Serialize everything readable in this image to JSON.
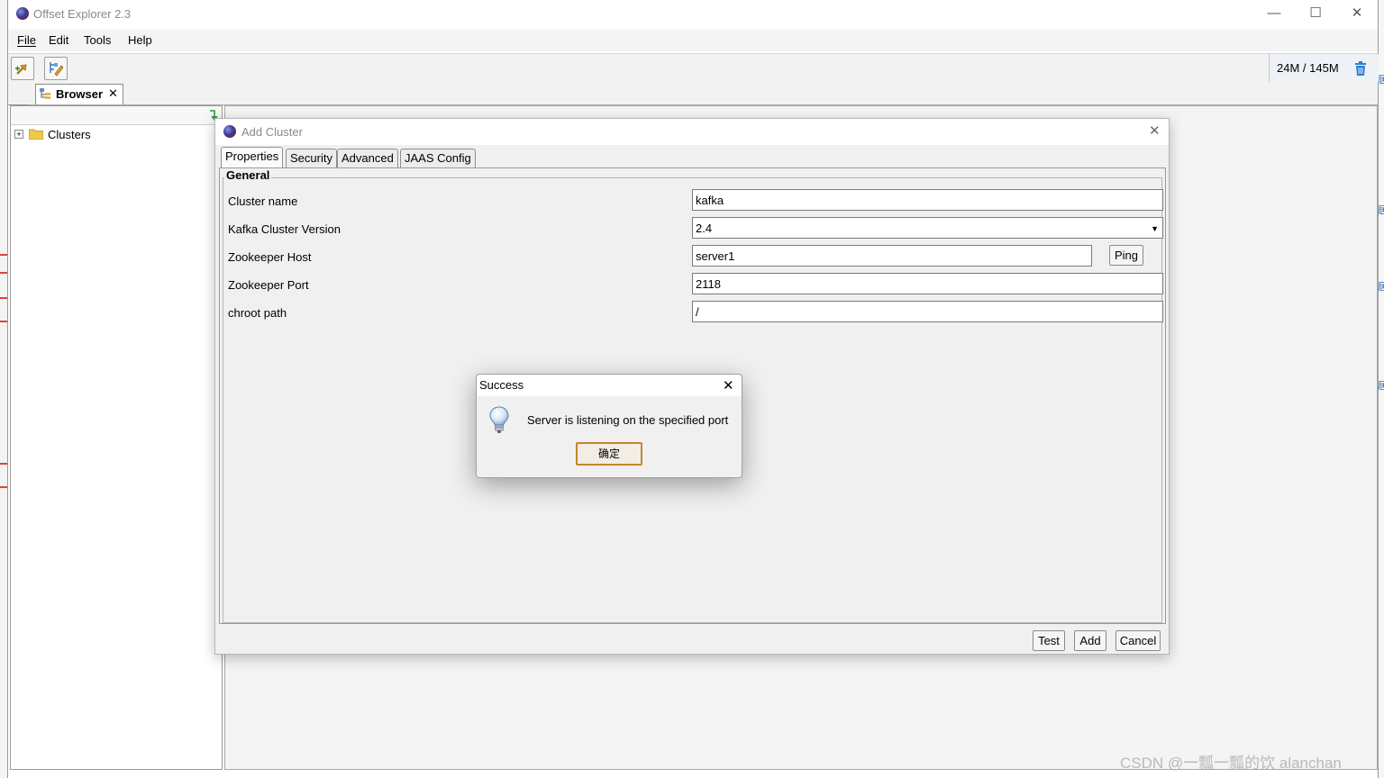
{
  "window": {
    "title": "Offset Explorer  2.3",
    "controls": [
      "minimize",
      "maximize",
      "close"
    ]
  },
  "menu": [
    "File",
    "Edit",
    "Tools",
    "Help"
  ],
  "toolbar": {
    "buttons": [
      "add-cluster-icon",
      "edit-cluster-icon"
    ],
    "memory": "24M / 145M",
    "gc_icon": "trash-icon"
  },
  "tabs": {
    "browser": "Browser"
  },
  "tree": {
    "root": "Clusters"
  },
  "add_cluster": {
    "title": "Add Cluster",
    "tabs": [
      "Properties",
      "Security",
      "Advanced",
      "JAAS Config"
    ],
    "active_tab": "Properties",
    "group": "General",
    "fields": [
      {
        "label": "Cluster name",
        "value": "kafka"
      },
      {
        "label": "Kafka Cluster Version",
        "value": "2.4"
      },
      {
        "label": "Zookeeper Host",
        "value": "server1"
      },
      {
        "label": "Zookeeper Port",
        "value": "2118"
      },
      {
        "label": "chroot path",
        "value": "/"
      }
    ],
    "ping_label": "Ping",
    "buttons": {
      "test": "Test",
      "add": "Add",
      "cancel": "Cancel"
    }
  },
  "success_dialog": {
    "title": "Success",
    "message": "Server is listening on the specified port",
    "ok_label": "确定",
    "icon": "lightbulb-icon"
  },
  "watermark": "CSDN @一瓢一瓢的饮 alanchan",
  "colors": {
    "ok_border": "#c5862e",
    "gc_icon": "#2d7fd1",
    "tree_add_arrow": "#2e9b3a"
  }
}
